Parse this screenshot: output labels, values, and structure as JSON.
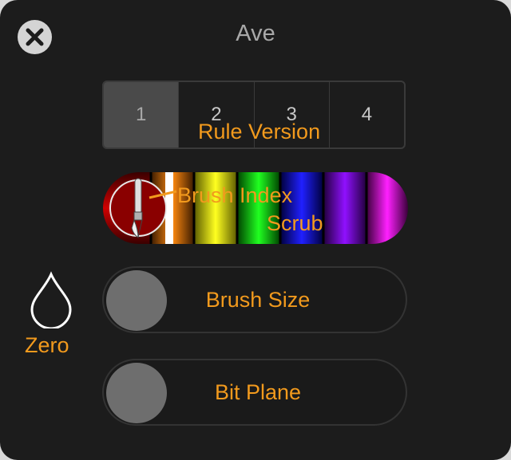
{
  "header": {
    "title": "Ave"
  },
  "rule_version": {
    "label": "Rule Version",
    "segments": [
      {
        "label": "1",
        "selected": true
      },
      {
        "label": "2",
        "selected": false
      },
      {
        "label": "3",
        "selected": false
      },
      {
        "label": "4",
        "selected": false
      }
    ]
  },
  "brush_scrub": {
    "label_line1": "Brush Index",
    "label_line2": "Scrub",
    "colors": [
      "#c00000",
      "#ff7a00",
      "#ffff00",
      "#00e000",
      "#0000ff",
      "#8000ff",
      "#ff00ff"
    ],
    "handle_icon": "paintbrush-icon"
  },
  "brush_size": {
    "label": "Brush Size",
    "on": false
  },
  "bit_plane": {
    "label": "Bit Plane",
    "on": false
  },
  "zero": {
    "label": "Zero",
    "icon": "drop-icon"
  },
  "colors": {
    "accent": "#f29a1d",
    "panel": "#1c1c1c"
  }
}
